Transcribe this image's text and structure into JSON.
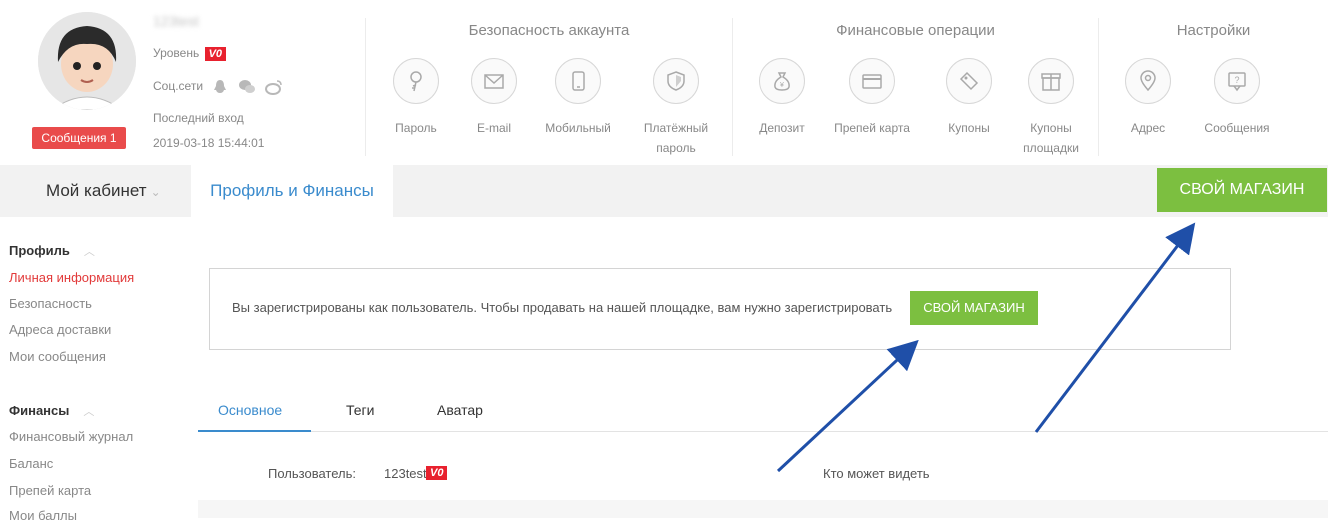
{
  "profile": {
    "username": "123test",
    "level_label": "Уровень",
    "level_badge": "V0",
    "social_label": "Соц.сети",
    "last_login_label": "Последний вход",
    "last_login_time": "2019-03-18 15:44:01",
    "messages_badge": "Сообщения 1"
  },
  "groups": [
    {
      "title": "Безопасность аккаунта",
      "items": [
        {
          "label": "Пароль",
          "icon": "key-icon"
        },
        {
          "label": "E-mail",
          "icon": "mail-icon"
        },
        {
          "label": "Мобильный",
          "icon": "phone-icon"
        },
        {
          "label": "Платёжный пароль",
          "icon": "shield-icon"
        }
      ]
    },
    {
      "title": "Финансовые операции",
      "items": [
        {
          "label": "Депозит",
          "icon": "money-bag-icon"
        },
        {
          "label": "Препей карта",
          "icon": "card-icon"
        },
        {
          "label": "Купоны",
          "icon": "coupon-icon"
        },
        {
          "label": "Купоны площадки",
          "icon": "gift-icon"
        }
      ]
    },
    {
      "title": "Настройки",
      "items": [
        {
          "label": "Адрес",
          "icon": "location-icon"
        },
        {
          "label": "Сообщения",
          "icon": "question-message-icon"
        }
      ]
    }
  ],
  "nav": {
    "cabinet": "Мой кабинет",
    "tab": "Профиль и Финансы",
    "shop_button": "СВОЙ МАГАЗИН"
  },
  "sidebar": {
    "profile_head": "Профиль",
    "profile_items": [
      "Личная информация",
      "Безопасность",
      "Адреса доставки",
      "Мои сообщения"
    ],
    "finance_head": "Финансы",
    "finance_items": [
      "Финансовый журнал",
      "Баланс",
      "Препей карта",
      "Мои баллы"
    ]
  },
  "notice": {
    "text": "Вы зарегистрированы как пользователь. Чтобы продавать на нашей площадке, вам нужно зарегистрировать",
    "button": "СВОЙ МАГАЗИН"
  },
  "tabs": [
    "Основное",
    "Теги",
    "Аватар"
  ],
  "info_row": {
    "user_label": "Пользователь:",
    "user_value": "123test",
    "badge": "V0",
    "visibility_label": "Кто может видеть"
  },
  "colors": {
    "accent_green": "#7cbf40",
    "accent_blue": "#3a8bcd",
    "badge_red": "#e8212e",
    "annotation_arrow": "#1f4fa8"
  }
}
